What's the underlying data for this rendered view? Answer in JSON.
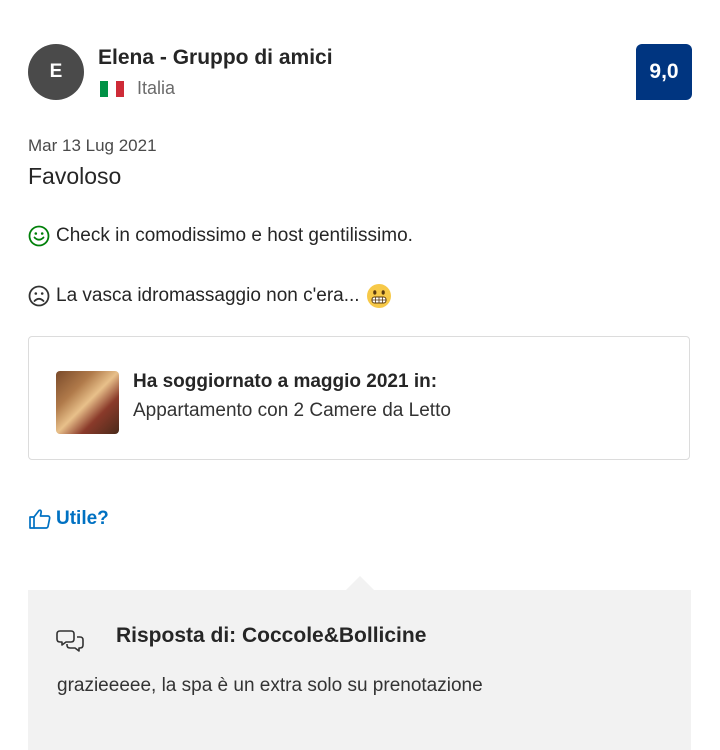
{
  "reviewer": {
    "initial": "E",
    "name": "Elena - Gruppo di amici",
    "country": "Italia",
    "flag_colors": [
      "#009246",
      "#ffffff",
      "#ce2b37"
    ]
  },
  "score": "9,0",
  "review": {
    "date": "Mar 13 Lug 2021",
    "title": "Favoloso",
    "positive": "Check in comodissimo e host gentilissimo.",
    "negative": "La vasca idromassaggio non c'era...",
    "negative_emoji": "grimacing-face"
  },
  "stay": {
    "title": "Ha soggiornato a maggio 2021 in:",
    "room": "Appartamento con 2 Camere da Letto"
  },
  "helpful_label": "Utile?",
  "reply": {
    "title": "Risposta di: Coccole&Bollicine",
    "text": "grazieeeee, la spa è un extra solo su prenotazione"
  },
  "colors": {
    "brand_blue": "#003580",
    "link_blue": "#0071c2",
    "positive_green": "#008009"
  }
}
